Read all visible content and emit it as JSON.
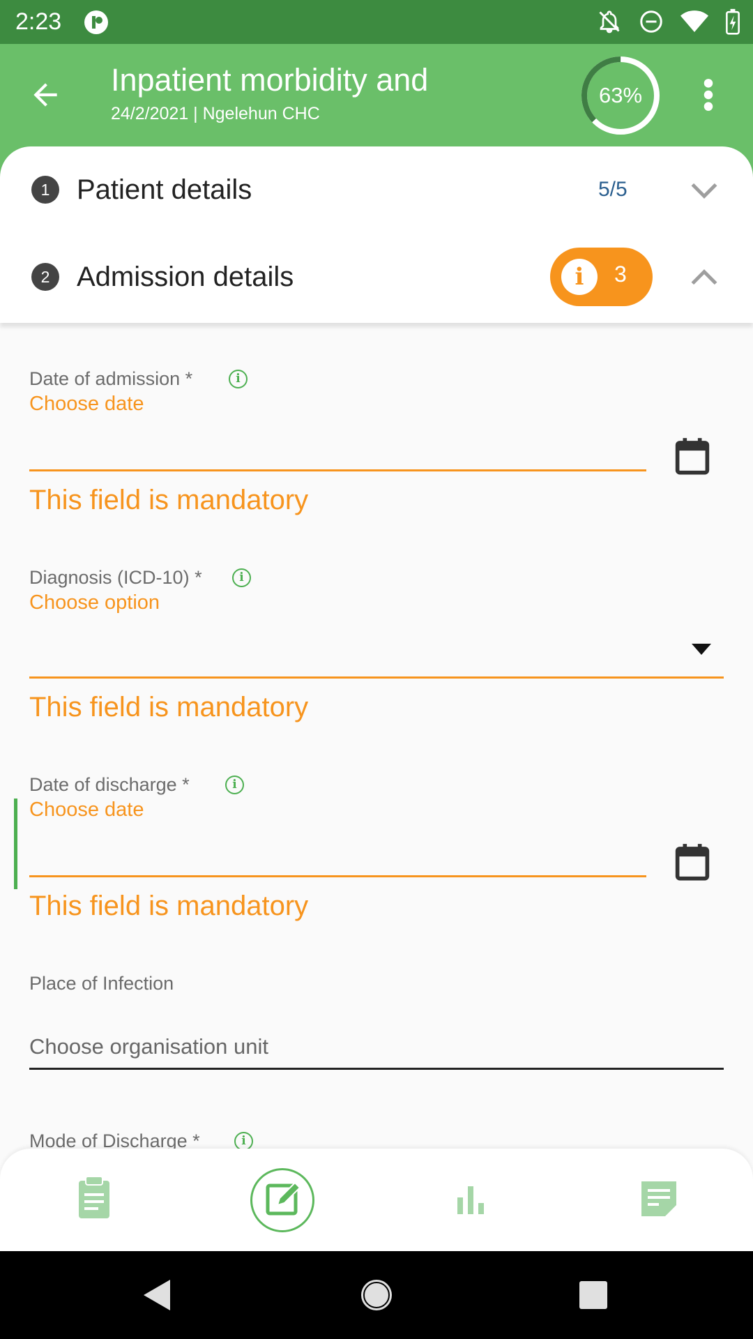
{
  "status_bar": {
    "time": "2:23",
    "icons": [
      "app-notification-icon",
      "notifications-off-icon",
      "do-not-disturb-icon",
      "wifi-icon",
      "battery-charging-icon"
    ]
  },
  "app_bar": {
    "title": "Inpatient morbidity and",
    "subtitle": "24/2/2021 | Ngelehun CHC",
    "progress_label": "63%",
    "progress_value": 0.63,
    "accent_color": "#6abf69"
  },
  "sections": [
    {
      "number": "1",
      "title": "Patient details",
      "count": "5/5",
      "expanded": false
    },
    {
      "number": "2",
      "title": "Admission details",
      "error_count": "3",
      "expanded": true
    }
  ],
  "fields": {
    "date_of_admission": {
      "label": "Date of admission *",
      "hint": "Choose date",
      "error": "This field is mandatory"
    },
    "diagnosis": {
      "label": "Diagnosis (ICD-10) *",
      "hint": "Choose option",
      "error": "This field is mandatory"
    },
    "date_of_discharge": {
      "label": "Date of discharge *",
      "hint": "Choose date",
      "error": "This field is mandatory"
    },
    "place_of_infection": {
      "label": "Place of Infection",
      "placeholder": "Choose organisation unit"
    },
    "mode_of_discharge": {
      "label": "Mode of Discharge *"
    }
  },
  "colors": {
    "status_bar": "#3d8b40",
    "warning": "#f7941d",
    "info_green": "#4caf50"
  },
  "bottom_nav": [
    "details-icon",
    "data-entry-icon",
    "analytics-icon",
    "notes-icon"
  ],
  "system_nav": [
    "back-icon",
    "home-icon",
    "recents-icon"
  ]
}
